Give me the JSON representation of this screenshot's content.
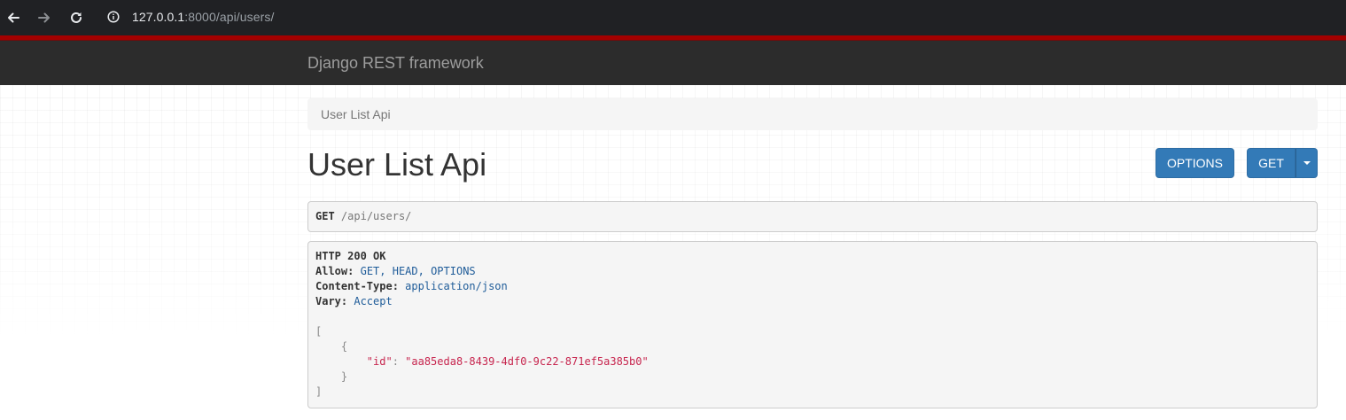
{
  "browser": {
    "url_host": "127.0.0.1",
    "url_rest": ":8000/api/users/"
  },
  "navbar": {
    "brand": "Django REST framework"
  },
  "breadcrumb": {
    "items": [
      "User List Api"
    ]
  },
  "page": {
    "title": "User List Api"
  },
  "buttons": {
    "options_label": "OPTIONS",
    "get_label": "GET"
  },
  "request": {
    "method": "GET",
    "path": "/api/users/"
  },
  "response": {
    "status": "HTTP 200 OK",
    "headers": [
      {
        "name": "Allow:",
        "value": "GET, HEAD, OPTIONS"
      },
      {
        "name": "Content-Type:",
        "value": "application/json"
      },
      {
        "name": "Vary:",
        "value": "Accept"
      }
    ],
    "body": {
      "open_bracket": "[",
      "open_brace": "{",
      "key": "\"id\"",
      "colon": ": ",
      "value": "\"aa85eda8-8439-4df0-9c22-871ef5a385b0\"",
      "close_brace": "}",
      "close_bracket": "]"
    }
  },
  "icons": {
    "back": "arrow-left-icon",
    "forward": "arrow-right-icon",
    "reload": "reload-icon",
    "site_info": "info-circle-icon",
    "dropdown": "caret-down-icon"
  },
  "colors": {
    "browser_bg": "#202124",
    "drf_red": "#a30000",
    "navbar_bg": "#2c2c2c",
    "primary_button": "#337ab7",
    "json_string": "#c7254e",
    "header_value": "#1f5c99"
  }
}
